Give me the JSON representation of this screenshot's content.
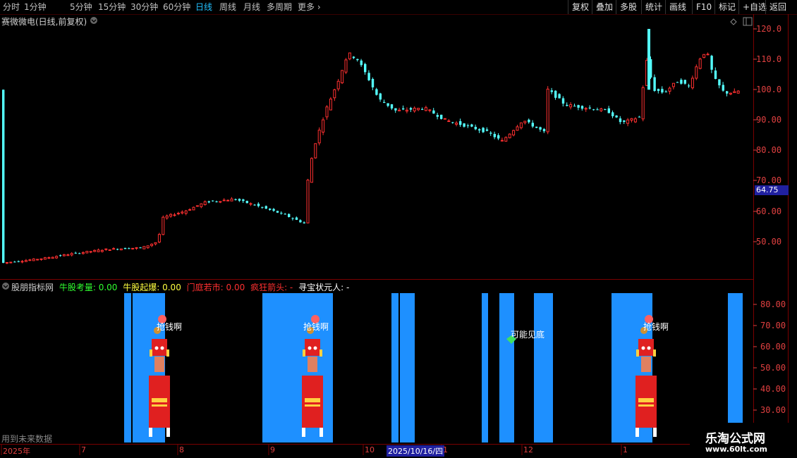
{
  "toolbar": {
    "periods": [
      "分时",
      "1分钟",
      "5分钟",
      "15分钟",
      "30分钟",
      "60分钟",
      "日线",
      "周线",
      "月线",
      "多周期",
      "更多"
    ],
    "active_period": "日线",
    "more_arrow": "›",
    "right_buttons": [
      "复权",
      "叠加",
      "多股",
      "统计",
      "画线",
      "F10",
      "标记",
      "+自选",
      "返回"
    ]
  },
  "main_chart": {
    "title": "赛微微电(日线,前复权)",
    "current_price_tag": "64.75",
    "y_axis_labels": [
      "120.0",
      "110.0",
      "100.0",
      "90.00",
      "80.00",
      "70.00",
      "60.00",
      "50.00"
    ],
    "up_color": "#ff3030",
    "down_color": "#54ffff"
  },
  "indicator": {
    "name": "股朋指标网",
    "items": [
      {
        "label": "牛股考量: 0.00",
        "color": "#30ff30"
      },
      {
        "label": "牛股起爆: 0.00",
        "color": "#ffff40"
      },
      {
        "label": "门庭若市: 0.00",
        "color": "#ff3030"
      },
      {
        "label": "疯狂箭头: -",
        "color": "#ff3030"
      },
      {
        "label": "寻宝状元人: -",
        "color": "#ffffff"
      }
    ],
    "y_axis_labels": [
      "80.00",
      "70.00",
      "60.00",
      "50.00",
      "40.00",
      "30.00"
    ],
    "bar_color": "#1e90ff",
    "signals": [
      {
        "label": "抢钱啊"
      },
      {
        "label": "抢钱啊"
      },
      {
        "label": "可能见底"
      },
      {
        "label": "抢钱啊"
      }
    ]
  },
  "footer": {
    "future_data": "用到未来数据",
    "dates": [
      "2025年",
      "7",
      "8",
      "9",
      "10",
      "2025/10/16/四",
      "1",
      "12",
      "1"
    ],
    "watermark_title": "乐淘公式网",
    "watermark_url": "www.60lt.com"
  },
  "chart_data": {
    "type": "candlestick",
    "y_range": [
      40,
      125
    ],
    "last_close": 64.75
  }
}
